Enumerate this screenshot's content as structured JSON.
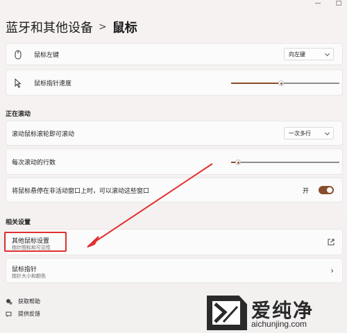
{
  "window": {
    "minimize": "—",
    "maximize": "□"
  },
  "breadcrumb": {
    "parent": "蓝牙和其他设备",
    "separator": ">",
    "current": "鼠标"
  },
  "settings": {
    "primary_button": {
      "label": "鼠标左键",
      "value": "向左键",
      "icon": "mouse-icon"
    },
    "pointer_speed": {
      "label": "鼠标指针速度",
      "icon": "pointer-icon",
      "level": 0.45
    },
    "scroll_section": "正在滚动",
    "scroll_wheel": {
      "label": "滚动鼠标滚轮即可滚动",
      "value": "一次多行"
    },
    "scroll_lines": {
      "label": "每次滚动的行数",
      "level": 0.03
    },
    "inactive_scroll": {
      "label": "将鼠标悬停在非活动窗口上时，可以滚动这些窗口",
      "state": "开"
    }
  },
  "related": {
    "section": "相关设置",
    "other_mouse": {
      "title": "其他鼠标设置",
      "subtitle": "指针图标和可见性"
    },
    "mouse_pointer": {
      "title": "鼠标指针",
      "subtitle": "指针大小和颜色"
    }
  },
  "footer": {
    "help": "获取帮助",
    "feedback": "提供反馈"
  },
  "watermark": {
    "brand": "爱纯净",
    "url": "aichunjing.com"
  },
  "colors": {
    "accent": "#8a4d2a",
    "highlight": "#e03030"
  }
}
